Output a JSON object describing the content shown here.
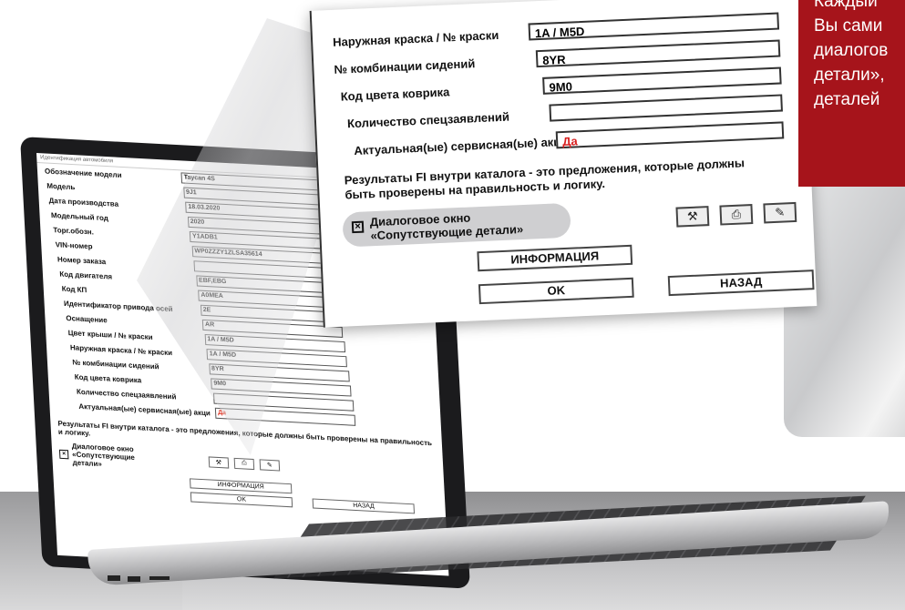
{
  "promo": {
    "lines": [
      "Каждый",
      "Вы сами",
      "диалогов",
      "детали»,",
      "деталей"
    ]
  },
  "dialog": {
    "rows": [
      {
        "label": "Наружная краска / № краски",
        "value": "1A / M5D"
      },
      {
        "label": "№ комбинации сидений",
        "value": "8YR"
      },
      {
        "label": "Код цвета коврика",
        "value": "9M0"
      },
      {
        "label": "Количество спецзаявлений",
        "value": ""
      },
      {
        "label": "Актуальная(ые) сервисная(ые) акци",
        "value": "Да"
      }
    ],
    "note": "Результаты  FI внутри каталога - это предложения, которые должны быть проверены на правильность и логику.",
    "checkbox_label": "Диалоговое окно «Сопутствующие детали»",
    "info_button": "ИНФОРМАЦИЯ",
    "ok_button": "OK",
    "back_button": "НАЗАД"
  },
  "laptop": {
    "window_title": "Идентификация автомобиля",
    "rows": [
      {
        "label": "Обозначение модели",
        "value": "Taycan 4S"
      },
      {
        "label": "Модель",
        "value": "9J1"
      },
      {
        "label": "Дата производства",
        "value": "18.03.2020"
      },
      {
        "label": "Модельный год",
        "value": "2020"
      },
      {
        "label": "Торг.обозн.",
        "value": "Y1ADB1"
      },
      {
        "label": "VIN-номер",
        "value": "WP0ZZZY1ZLSA35614"
      },
      {
        "label": "Номер заказа",
        "value": ""
      },
      {
        "label": "Код двигателя",
        "value": "EBF,EBG"
      },
      {
        "label": "Код КП",
        "value": "A0MEA"
      },
      {
        "label": "Идентификатор привода осей",
        "value": "2E"
      },
      {
        "label": "Оснащение",
        "value": "AR"
      },
      {
        "label": "Цвет крыши / № краски",
        "value": "1A / M5D"
      },
      {
        "label": "Наружная краска / № краски",
        "value": "1A / M5D"
      },
      {
        "label": "№ комбинации сидений",
        "value": "8YR"
      },
      {
        "label": "Код цвета коврика",
        "value": "9M0"
      },
      {
        "label": "Количество спецзаявлений",
        "value": ""
      },
      {
        "label": "Актуальная(ые) сервисная(ые) акци",
        "value": "Да"
      }
    ],
    "note": "Результаты  FI внутри каталога - это предложения, которые должны быть проверены на правильность и логику.",
    "checkbox_label": "Диалоговое окно «Сопутствующие детали»",
    "info_button": "ИНФОРМАЦИЯ",
    "ok_button": "OK",
    "back_button": "НАЗАД"
  },
  "colors": {
    "accent_red": "#a6141b",
    "value_red": "#d81f1f"
  },
  "icons": [
    "hammer-icon",
    "print-icon",
    "pencil-icon"
  ]
}
